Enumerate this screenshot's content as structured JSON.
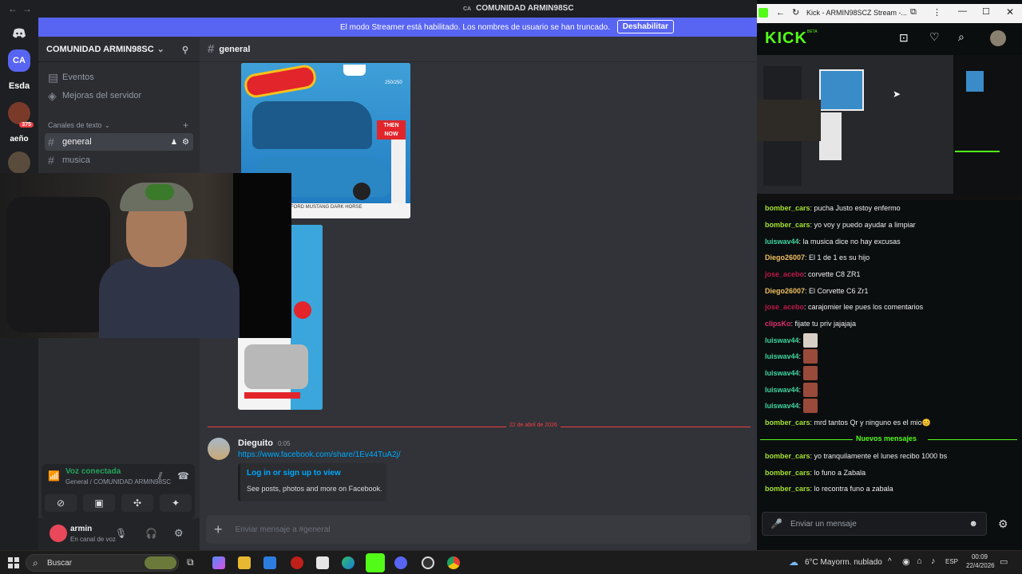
{
  "discord": {
    "window_title_prefix": "CA",
    "window_title": "COMUNIDAD ARMIN98SC",
    "streamer_banner": {
      "message": "El modo Streamer está habilitado. Los nombres de usuario se han truncado.",
      "disable_label": "Deshabilitar"
    },
    "servers": [
      {
        "label": "CA",
        "badge": ""
      },
      {
        "label": "Esda",
        "badge": ""
      },
      {
        "label": "",
        "badge": "375"
      },
      {
        "label": "aeño",
        "badge": ""
      }
    ],
    "guild_name": "COMUNIDAD ARMIN98SC",
    "sidebar": {
      "events": "Eventos",
      "boosts": "Mejoras del servidor",
      "category": "Canales de texto",
      "channels": [
        "general",
        "musica"
      ]
    },
    "voice": {
      "status": "Voz conectada",
      "location": "General / COMUNIDAD ARMIN98SC"
    },
    "user": {
      "name": "armin",
      "status": "En canal de voz"
    },
    "chat": {
      "channel": "general",
      "product_card_text": "FORD MUSTANG DARK HORSE",
      "product_card_count": "250/250",
      "then_now": "THEN NOW",
      "date_divider": "22 de abril de 2026",
      "message": {
        "author": "Dieguito",
        "time": "0:05",
        "link": "https://www.facebook.com/share/1Ev44TuA2j/",
        "embed_title": "Log in or sign up to view",
        "embed_desc": "See posts, photos and more on Facebook."
      },
      "composer_placeholder": "Enviar mensaje a #general"
    }
  },
  "kick": {
    "window_title": "Kick - ARMIN98SCZ Stream -...",
    "logo": "KICK",
    "logo_badge": "BETA",
    "chat": [
      {
        "user": "bomber_cars",
        "color": "#a6e22e",
        "text": ": pucha Justo estoy enfermo"
      },
      {
        "user": "bomber_cars",
        "color": "#a6e22e",
        "text": ": yo voy y puedo ayudar a limpiar"
      },
      {
        "user": "luiswav44",
        "color": "#3fd6a0",
        "text": ": la musica dice no hay excusas"
      },
      {
        "user": "Diego26007",
        "color": "#f0c060",
        "text": ": El 1 de 1 es su hijo"
      },
      {
        "user": "jose_acebo",
        "color": "#c0184a",
        "text": ": corvette C8 ZR1"
      },
      {
        "user": "Diego26007",
        "color": "#f0c060",
        "text": ": El Corvette C6 Zr1"
      },
      {
        "user": "jose_acebo",
        "color": "#c0184a",
        "text": ": carajomier lee pues los comentarios"
      },
      {
        "user": "clipsKo",
        "color": "#e0306a",
        "text": ": fijate tu priv jajajaja"
      },
      {
        "user": "luiswav44",
        "color": "#3fd6a0",
        "text": ":"
      },
      {
        "user": "luiswav44",
        "color": "#3fd6a0",
        "text": ":"
      },
      {
        "user": "luiswav44",
        "color": "#3fd6a0",
        "text": ":"
      },
      {
        "user": "luiswav44",
        "color": "#3fd6a0",
        "text": ":"
      },
      {
        "user": "luiswav44",
        "color": "#3fd6a0",
        "text": ":"
      },
      {
        "user": "bomber_cars",
        "color": "#a6e22e",
        "text": ": mrd tantos Qr y ninguno es el mio😊"
      },
      {
        "user": "bomber_cars",
        "color": "#a6e22e",
        "text": ": yo tranquilamente el lunes recibo 1000 bs"
      },
      {
        "user": "bomber_cars",
        "color": "#a6e22e",
        "text": ": lo funo a Zabala"
      },
      {
        "user": "bomber_cars",
        "color": "#a6e22e",
        "text": ": lo recontra funo a zabala"
      }
    ],
    "new_messages_label": "Nuevos mensajes",
    "input_placeholder": "Enviar un mensaje"
  },
  "taskbar": {
    "search_label": "Buscar",
    "weather": "6°C  Mayorm. nublado",
    "language": "ESP",
    "time": "00:09",
    "date": "22/4/2026"
  },
  "colors": {
    "discord_blurple": "#5865f2",
    "kick_green": "#53fc18",
    "link_blue": "#00a8fc"
  }
}
